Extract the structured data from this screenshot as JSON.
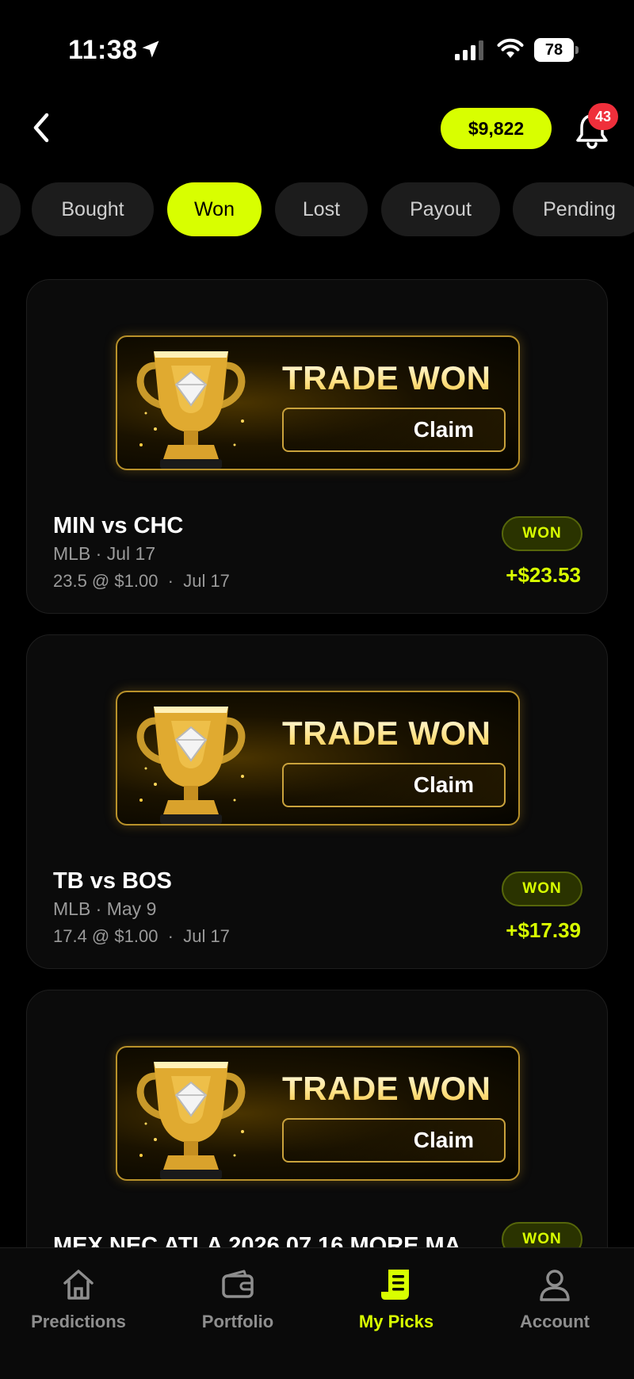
{
  "status_bar": {
    "time": "11:38",
    "battery": "78"
  },
  "header": {
    "balance": "$9,822",
    "notification_count": "43"
  },
  "tabs": [
    {
      "label": "Bought",
      "active": false
    },
    {
      "label": "Won",
      "active": true
    },
    {
      "label": "Lost",
      "active": false
    },
    {
      "label": "Payout",
      "active": false
    },
    {
      "label": "Pending",
      "active": false
    }
  ],
  "picks": [
    {
      "banner_title": "TRADE WON",
      "claim_label": "Claim",
      "matchup": "MIN vs CHC",
      "league_date": "MLB · Jul 17",
      "details": "23.5 @ $1.00  ·  Jul 17",
      "status": "WON",
      "payout": "+$23.53"
    },
    {
      "banner_title": "TRADE WON",
      "claim_label": "Claim",
      "matchup": "TB vs BOS",
      "league_date": "MLB · May 9",
      "details": "17.4 @ $1.00  ·  Jul 17",
      "status": "WON",
      "payout": "+$17.39"
    },
    {
      "banner_title": "TRADE WON",
      "claim_label": "Claim",
      "matchup": "MEX NEC ATLA 2026 07 16 MORE MA",
      "status": "WON"
    }
  ],
  "bottom_nav": [
    {
      "label": "Predictions",
      "icon": "home-icon",
      "active": false
    },
    {
      "label": "Portfolio",
      "icon": "wallet-icon",
      "active": false
    },
    {
      "label": "My Picks",
      "icon": "receipt-icon",
      "active": true
    },
    {
      "label": "Account",
      "icon": "person-icon",
      "active": false
    }
  ],
  "colors": {
    "accent": "#d8ff00",
    "background": "#000000",
    "badge": "#ef2f3b",
    "gold": "#c9a23c"
  }
}
